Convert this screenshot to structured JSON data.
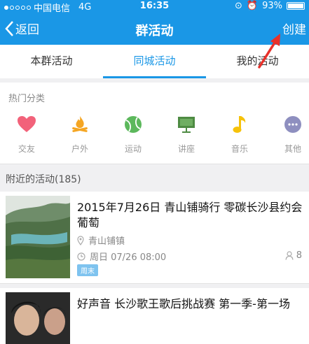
{
  "status": {
    "carrier": "中国电信",
    "network": "4G",
    "time": "16:35",
    "battery": "93%"
  },
  "nav": {
    "back_label": "返回",
    "title": "群活动",
    "create_label": "创建"
  },
  "tabs": [
    {
      "label": "本群活动"
    },
    {
      "label": "同城活动"
    },
    {
      "label": "我的活动"
    }
  ],
  "categories": {
    "title": "热门分类",
    "items": [
      {
        "label": "交友",
        "icon": "heart-icon",
        "color": "#f2627a"
      },
      {
        "label": "户外",
        "icon": "campfire-icon",
        "color": "#f5a623"
      },
      {
        "label": "运动",
        "icon": "tennis-ball-icon",
        "color": "#5cb85c"
      },
      {
        "label": "讲座",
        "icon": "board-icon",
        "color": "#4e8b43"
      },
      {
        "label": "音乐",
        "icon": "music-note-icon",
        "color": "#f6c20a"
      },
      {
        "label": "其他",
        "icon": "more-icon",
        "color": "#8e8fbf"
      }
    ]
  },
  "nearby": {
    "title": "附近的活动(185)"
  },
  "activities": [
    {
      "title": "2015年7月26日 青山铺骑行 零碳长沙县约会葡萄",
      "location": "青山铺镇",
      "time": "周日 07/26 08:00",
      "count": "8",
      "tag": "周末"
    },
    {
      "title": "好声音 长沙歌王歌后挑战赛 第一季-第一场"
    }
  ]
}
